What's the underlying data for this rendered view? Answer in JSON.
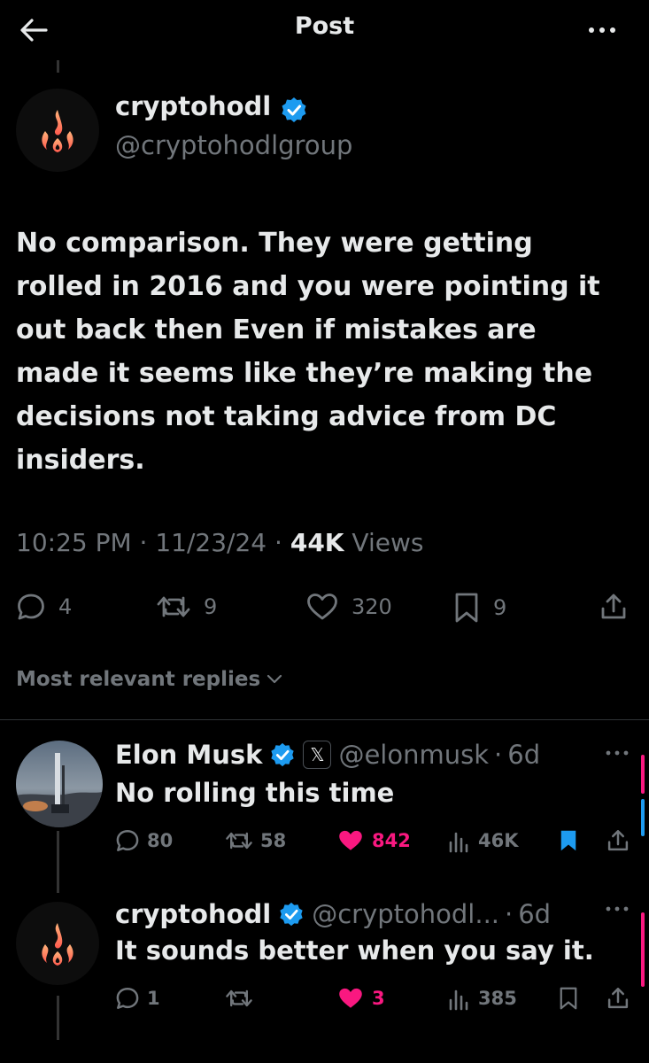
{
  "header": {
    "title": "Post",
    "back_icon": "arrow-left-icon",
    "more_icon": "more-horizontal-icon"
  },
  "post": {
    "author_name": "cryptohodl",
    "author_handle": "@cryptohodlgroup",
    "verified": true,
    "text_lines": [
      "No comparison. They were getting",
      "rolled in 2016 and you were pointing it",
      "out back then   Even if mistakes are",
      "made it seems like they’re making the",
      "decisions not taking advice from DC",
      "insiders."
    ],
    "time": "10:25 PM",
    "date": "11/23/24",
    "views_count": "44K",
    "views_label": "Views",
    "separator": "·",
    "stats": {
      "replies": "4",
      "reposts": "9",
      "likes": "320",
      "bookmarks": "9"
    }
  },
  "sort": {
    "label": "Most relevant replies"
  },
  "replies": [
    {
      "name": "Elon Musk",
      "handle": "@elonmusk",
      "time": "6d",
      "separator": "·",
      "badge": "𝕏",
      "text": "No rolling this time",
      "stats": {
        "replies": "80",
        "reposts": "58",
        "likes": "842",
        "views": "46K"
      },
      "liked": true,
      "bookmarked": true
    },
    {
      "name": "cryptohodl",
      "handle": "@cryptohodl...",
      "time": "6d",
      "separator": "·",
      "text": "It sounds better when you say it.",
      "stats": {
        "replies": "1",
        "reposts": "",
        "likes": "3",
        "views": "385"
      },
      "liked": true,
      "bookmarked": false
    }
  ],
  "colors": {
    "background": "#000000",
    "text": "#e7e9ea",
    "muted": "#71767b",
    "blue": "#1d9bf0",
    "pink": "#f91880"
  }
}
